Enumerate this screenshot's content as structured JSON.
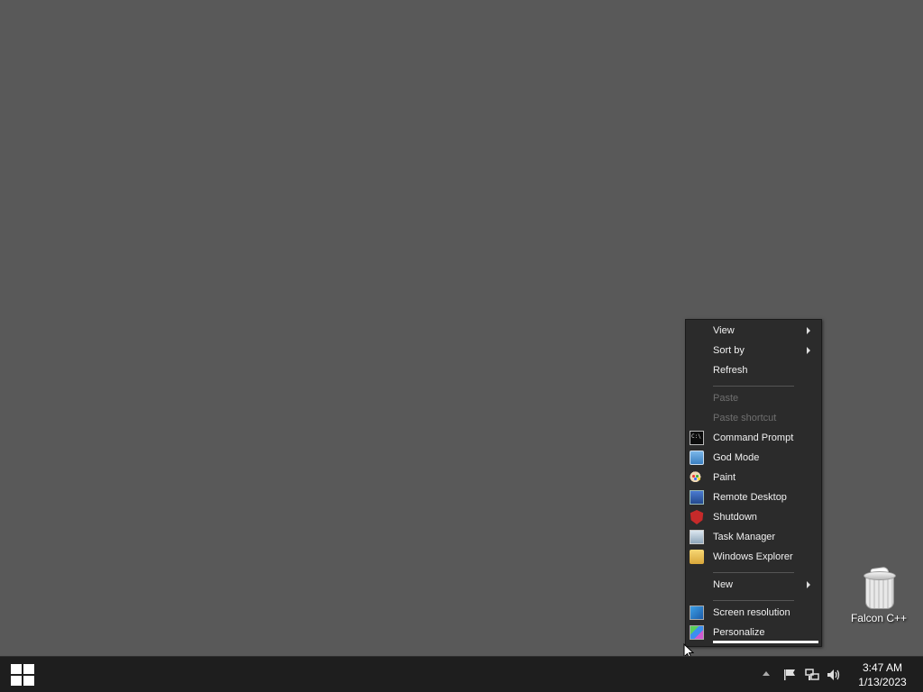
{
  "desktop": {
    "icons": [
      {
        "label": "Falcon C++",
        "icon": "recycle-bin-icon"
      }
    ]
  },
  "context_menu": {
    "items": [
      {
        "label": "View",
        "submenu": true,
        "enabled": true
      },
      {
        "label": "Sort by",
        "submenu": true,
        "enabled": true
      },
      {
        "label": "Refresh",
        "enabled": true
      },
      {
        "label": "Paste",
        "enabled": false
      },
      {
        "label": "Paste shortcut",
        "enabled": false
      },
      {
        "label": "Command Prompt",
        "icon": "command-prompt-icon",
        "enabled": true
      },
      {
        "label": "God Mode",
        "icon": "god-mode-icon",
        "enabled": true
      },
      {
        "label": "Paint",
        "icon": "paint-icon",
        "enabled": true
      },
      {
        "label": "Remote Desktop",
        "icon": "remote-desktop-icon",
        "enabled": true
      },
      {
        "label": "Shutdown",
        "icon": "shutdown-icon",
        "enabled": true
      },
      {
        "label": "Task Manager",
        "icon": "task-manager-icon",
        "enabled": true
      },
      {
        "label": "Windows Explorer",
        "icon": "windows-explorer-icon",
        "enabled": true
      },
      {
        "label": "New",
        "submenu": true,
        "enabled": true
      },
      {
        "label": "Screen resolution",
        "icon": "screen-resolution-icon",
        "enabled": true
      },
      {
        "label": "Personalize",
        "icon": "personalize-icon",
        "enabled": true
      }
    ]
  },
  "taskbar": {
    "start_icon": "windows-start-icon",
    "tray_icons": [
      "show-hidden-icons-chevron",
      "action-center-flag-icon",
      "network-icon",
      "volume-icon"
    ],
    "clock": {
      "time": "3:47 AM",
      "date": "1/13/2023"
    }
  },
  "colors": {
    "desktop": "#595959",
    "menu": "#2b2b2b",
    "taskbar": "#1e1e1e"
  }
}
